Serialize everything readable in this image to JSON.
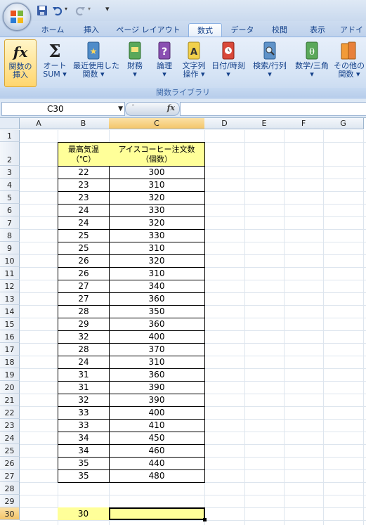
{
  "ribbon_tabs": [
    "ホーム",
    "挿入",
    "ページ レイアウト",
    "数式",
    "データ",
    "校閲",
    "表示",
    "アドイ"
  ],
  "active_tab": "数式",
  "ribbon_buttons": [
    {
      "id": "insert-function",
      "line1": "関数の",
      "line2": "挿入",
      "icon": "fx-icon"
    },
    {
      "id": "autosum",
      "line1": "オート",
      "line2": "SUM ▾",
      "icon": "sigma-icon"
    },
    {
      "id": "recent",
      "line1": "最近使用した",
      "line2": "関数 ▾",
      "icon": "star-book-icon"
    },
    {
      "id": "financial",
      "line1": "財務",
      "line2": "▾",
      "icon": "money-book-icon"
    },
    {
      "id": "logical",
      "line1": "論理",
      "line2": "▾",
      "icon": "question-book-icon"
    },
    {
      "id": "text",
      "line1": "文字列",
      "line2": "操作 ▾",
      "icon": "letter-a-book-icon"
    },
    {
      "id": "datetime",
      "line1": "日付/時刻",
      "line2": "▾",
      "icon": "clock-book-icon"
    },
    {
      "id": "lookup",
      "line1": "検索/行列",
      "line2": "▾",
      "icon": "magnifier-book-icon"
    },
    {
      "id": "math",
      "line1": "数学/三角",
      "line2": "▾",
      "icon": "theta-book-icon"
    },
    {
      "id": "more",
      "line1": "その他の",
      "line2": "関数 ▾",
      "icon": "more-books-icon"
    }
  ],
  "ribbon_group_label": "関数ライブラリ",
  "formula_bar": {
    "name_box": "C30",
    "fx_label": "fx",
    "formula": ""
  },
  "columns": [
    "A",
    "B",
    "C",
    "D",
    "E",
    "F",
    "G"
  ],
  "selected_column": "C",
  "rows": [
    "1",
    "2",
    "3",
    "4",
    "5",
    "6",
    "7",
    "8",
    "9",
    "10",
    "11",
    "12",
    "13",
    "14",
    "15",
    "16",
    "17",
    "18",
    "19",
    "20",
    "21",
    "22",
    "23",
    "24",
    "25",
    "26",
    "27",
    "28",
    "29",
    "30"
  ],
  "selected_row": "30",
  "table": {
    "header_b": [
      "最高気温",
      "（℃）"
    ],
    "header_c": [
      "アイスコーヒー注文数",
      "（個数）"
    ],
    "temps": [
      "22",
      "23",
      "23",
      "24",
      "24",
      "25",
      "25",
      "26",
      "26",
      "27",
      "27",
      "28",
      "29",
      "32",
      "28",
      "24",
      "31",
      "31",
      "32",
      "33",
      "33",
      "34",
      "34",
      "35",
      "35"
    ],
    "orders": [
      "300",
      "310",
      "320",
      "330",
      "320",
      "330",
      "310",
      "320",
      "310",
      "340",
      "360",
      "350",
      "360",
      "400",
      "370",
      "310",
      "360",
      "390",
      "390",
      "400",
      "410",
      "450",
      "460",
      "440",
      "480"
    ]
  },
  "answer": {
    "b30": "30",
    "c30": ""
  },
  "colors": {
    "header_fill": "#ffff99",
    "selection": "#f3c56a",
    "ribbon": "#d6e4f5"
  }
}
